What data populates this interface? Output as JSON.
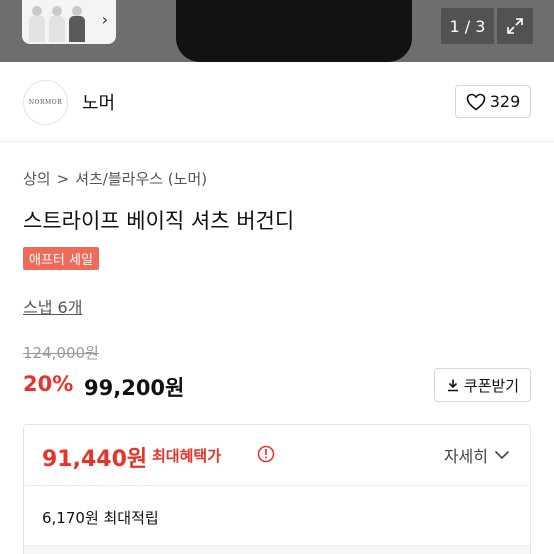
{
  "gallery": {
    "counter": "1 / 3",
    "thumbnails": [
      "thumb-1",
      "thumb-2",
      "thumb-3"
    ]
  },
  "shop": {
    "logo_text": "NORMOR",
    "name": "노머",
    "likes": "329"
  },
  "breadcrumb": {
    "category": "상의",
    "separator": ">",
    "subcategory": "셔츠/블라우스 (노머)"
  },
  "product": {
    "title": "스트라이프 베이직 셔츠 버건디",
    "badge": "애프터 세일",
    "snap_link": "스냅 6개"
  },
  "price": {
    "original": "124,000원",
    "discount": "20%",
    "sale": "99,200원",
    "coupon_label": "쿠폰받기"
  },
  "benefit": {
    "max_price": "91,440원",
    "max_label": "최대혜택가",
    "detail_label": "자세히",
    "points": "6,170원 최대적립"
  },
  "colors": {
    "accent_red": "#e8322b",
    "badge_bg": "#ef6a59"
  },
  "icons": {
    "like": "heart-icon",
    "expand": "expand-icon",
    "coupon": "download-icon",
    "info": "info-icon",
    "detail": "chevron-down-icon",
    "thumb_next": "chevron-right-icon"
  }
}
